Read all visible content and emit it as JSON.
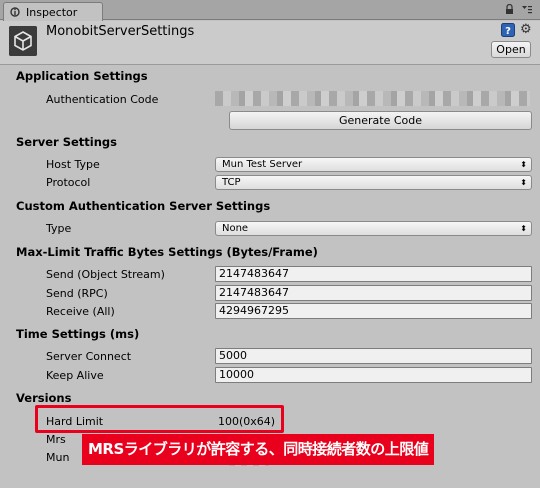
{
  "window": {
    "tab_label": "Inspector"
  },
  "header": {
    "asset_title": "MonobitServerSettings",
    "open_button": "Open"
  },
  "sections": {
    "application": "Application Settings",
    "server": "Server Settings",
    "custom_auth": "Custom Authentication Server Settings",
    "max_limit": "Max-Limit Traffic Bytes Settings (Bytes/Frame)",
    "time": "Time Settings (ms)",
    "versions": "Versions"
  },
  "application": {
    "auth_code_label": "Authentication Code",
    "generate_button": "Generate Code"
  },
  "server": {
    "host_type_label": "Host Type",
    "host_type_value": "Mun Test Server",
    "protocol_label": "Protocol",
    "protocol_value": "TCP"
  },
  "custom_auth": {
    "type_label": "Type",
    "type_value": "None"
  },
  "max_limit": {
    "send_object_label": "Send (Object Stream)",
    "send_object_value": "2147483647",
    "send_rpc_label": "Send (RPC)",
    "send_rpc_value": "2147483647",
    "receive_label": "Receive (All)",
    "receive_value": "4294967295"
  },
  "time": {
    "server_connect_label": "Server Connect",
    "server_connect_value": "5000",
    "keep_alive_label": "Keep Alive",
    "keep_alive_value": "10000"
  },
  "versions": {
    "hard_limit_label": "Hard Limit",
    "hard_limit_value": "100(0x64)",
    "mrs_label": "Mrs",
    "mun_label": "Mun"
  },
  "annotation": {
    "text": "MRSライブラリが許容する、同時接続者数の上限値"
  },
  "colors": {
    "highlight": "#e8001c",
    "panel": "#c2c2c2"
  }
}
